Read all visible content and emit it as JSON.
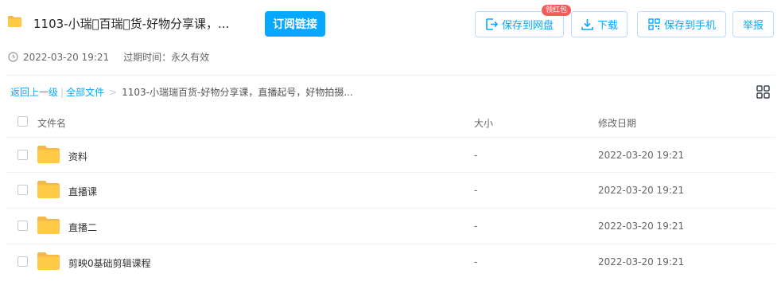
{
  "header": {
    "title": "1103-小瑞\u0000百瑞\u0000货-好物分享课，...",
    "subscribe_label": "订阅链接",
    "save_to_disk_label": "保存到网盘",
    "badge_label": "领红包",
    "download_label": "下载",
    "save_to_phone_label": "保存到手机",
    "report_label": "举报"
  },
  "meta": {
    "share_time": "2022-03-20 19:21",
    "expire_text": "过期时间：永久有效"
  },
  "breadcrumb": {
    "back": "返回上一级",
    "sep": "|",
    "all_files": "全部文件",
    "arrow": ">",
    "current": "1103-小瑞瑞百货-好物分享课，直播起号，好物拍摄..."
  },
  "table": {
    "columns": {
      "name": "文件名",
      "size": "大小",
      "date": "修改日期"
    },
    "rows": [
      {
        "name": "资料",
        "size": "-",
        "date": "2022-03-20 19:21"
      },
      {
        "name": "直播课",
        "size": "-",
        "date": "2022-03-20 19:21"
      },
      {
        "name": "直播二",
        "size": "-",
        "date": "2022-03-20 19:21"
      },
      {
        "name": "剪映0基础剪辑课程",
        "size": "-",
        "date": "2022-03-20 19:21"
      }
    ]
  },
  "icons": {
    "header": "folder-icon",
    "time": "clock-icon",
    "view": "grid-view-icon",
    "rows": "folder-icon"
  },
  "colors": {
    "accent": "#06a7ff",
    "badge": "#f25d5a",
    "folder": "#ffcb46"
  }
}
